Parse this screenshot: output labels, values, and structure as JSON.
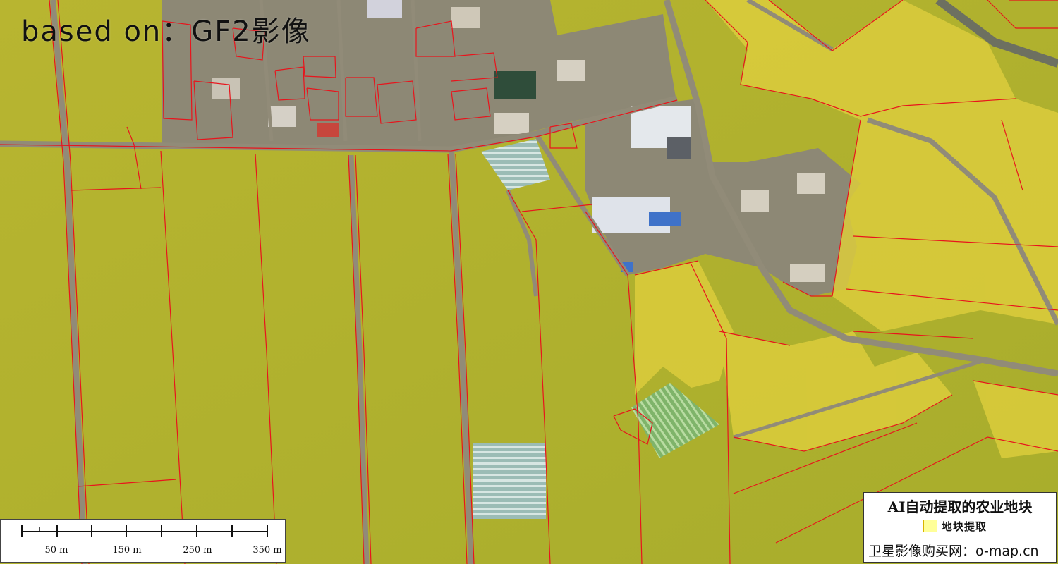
{
  "map": {
    "overlay_title": "based on：GF2影像",
    "colors": {
      "field_yellow": "#d6c93a",
      "field_green": "#a9b534",
      "boundary": "#e8141c",
      "road": "#8f8a76",
      "settlement": "#8a8574",
      "greenhouse": "#9fc2bd"
    }
  },
  "scalebar": {
    "labels": [
      "50 m",
      "150 m",
      "250 m",
      "350 m"
    ]
  },
  "legend": {
    "title": "AI自动提取的农业地块",
    "item_label": "地块提取",
    "swatch_color": "#ffff99",
    "site_text": "卫星影像购买网：o-map.cn"
  }
}
